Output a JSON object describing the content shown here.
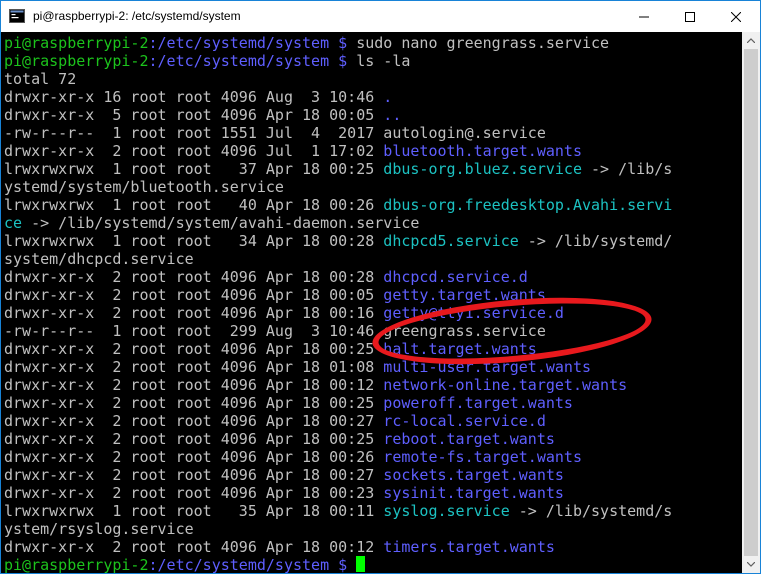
{
  "window": {
    "title": "pi@raspberrypi-2: /etc/systemd/system"
  },
  "controls": {
    "minimize": "minimize",
    "maximize": "maximize",
    "close": "close"
  },
  "lines": [
    [
      {
        "t": "pi@raspberrypi-2",
        "c": "g"
      },
      {
        "t": ":/etc/systemd/system $ ",
        "c": "b"
      },
      {
        "t": "sudo nano greengrass.service",
        "c": "w"
      }
    ],
    [
      {
        "t": "pi@raspberrypi-2",
        "c": "g"
      },
      {
        "t": ":/etc/systemd/system $ ",
        "c": "b"
      },
      {
        "t": "ls -la",
        "c": "w"
      }
    ],
    [
      {
        "t": "total 72",
        "c": "w"
      }
    ],
    [
      {
        "t": "drwxr-xr-x 16 root root 4096 Aug  3 10:46 ",
        "c": "w"
      },
      {
        "t": ".",
        "c": "b"
      }
    ],
    [
      {
        "t": "drwxr-xr-x  5 root root 4096 Apr 18 00:05 ",
        "c": "w"
      },
      {
        "t": "..",
        "c": "b"
      }
    ],
    [
      {
        "t": "-rw-r--r--  1 root root 1551 Jul  4  2017 autologin@.service",
        "c": "w"
      }
    ],
    [
      {
        "t": "drwxr-xr-x  2 root root 4096 Jul  1 17:02 ",
        "c": "w"
      },
      {
        "t": "bluetooth.target.wants",
        "c": "b"
      }
    ],
    [
      {
        "t": "lrwxrwxrwx  1 root root   37 Apr 18 00:25 ",
        "c": "w"
      },
      {
        "t": "dbus-org.bluez.service",
        "c": "c"
      },
      {
        "t": " -> /lib/s",
        "c": "w"
      }
    ],
    [
      {
        "t": "ystemd/system/bluetooth.service",
        "c": "w"
      }
    ],
    [
      {
        "t": "lrwxrwxrwx  1 root root   40 Apr 18 00:26 ",
        "c": "w"
      },
      {
        "t": "dbus-org.freedesktop.Avahi.servi",
        "c": "c"
      }
    ],
    [
      {
        "t": "ce",
        "c": "c"
      },
      {
        "t": " -> /lib/systemd/system/avahi-daemon.service",
        "c": "w"
      }
    ],
    [
      {
        "t": "lrwxrwxrwx  1 root root   34 Apr 18 00:28 ",
        "c": "w"
      },
      {
        "t": "dhcpcd5.service",
        "c": "c"
      },
      {
        "t": " -> /lib/systemd/",
        "c": "w"
      }
    ],
    [
      {
        "t": "system/dhcpcd.service",
        "c": "w"
      }
    ],
    [
      {
        "t": "drwxr-xr-x  2 root root 4096 Apr 18 00:28 ",
        "c": "w"
      },
      {
        "t": "dhcpcd.service.d",
        "c": "b"
      }
    ],
    [
      {
        "t": "drwxr-xr-x  2 root root 4096 Apr 18 00:05 ",
        "c": "w"
      },
      {
        "t": "getty.target.wants",
        "c": "b"
      }
    ],
    [
      {
        "t": "drwxr-xr-x  2 root root 4096 Apr 18 00:16 ",
        "c": "w"
      },
      {
        "t": "getty@tty1.service.d",
        "c": "b"
      }
    ],
    [
      {
        "t": "-rw-r--r--  1 root root  299 Aug  3 10:46 greengrass.service",
        "c": "w"
      }
    ],
    [
      {
        "t": "drwxr-xr-x  2 root root 4096 Apr 18 00:25 ",
        "c": "w"
      },
      {
        "t": "halt.target.wants",
        "c": "b"
      }
    ],
    [
      {
        "t": "drwxr-xr-x  2 root root 4096 Apr 18 01:08 ",
        "c": "w"
      },
      {
        "t": "multi-user.target.wants",
        "c": "b"
      }
    ],
    [
      {
        "t": "drwxr-xr-x  2 root root 4096 Apr 18 00:12 ",
        "c": "w"
      },
      {
        "t": "network-online.target.wants",
        "c": "b"
      }
    ],
    [
      {
        "t": "drwxr-xr-x  2 root root 4096 Apr 18 00:25 ",
        "c": "w"
      },
      {
        "t": "poweroff.target.wants",
        "c": "b"
      }
    ],
    [
      {
        "t": "drwxr-xr-x  2 root root 4096 Apr 18 00:27 ",
        "c": "w"
      },
      {
        "t": "rc-local.service.d",
        "c": "b"
      }
    ],
    [
      {
        "t": "drwxr-xr-x  2 root root 4096 Apr 18 00:25 ",
        "c": "w"
      },
      {
        "t": "reboot.target.wants",
        "c": "b"
      }
    ],
    [
      {
        "t": "drwxr-xr-x  2 root root 4096 Apr 18 00:26 ",
        "c": "w"
      },
      {
        "t": "remote-fs.target.wants",
        "c": "b"
      }
    ],
    [
      {
        "t": "drwxr-xr-x  2 root root 4096 Apr 18 00:27 ",
        "c": "w"
      },
      {
        "t": "sockets.target.wants",
        "c": "b"
      }
    ],
    [
      {
        "t": "drwxr-xr-x  2 root root 4096 Apr 18 00:23 ",
        "c": "w"
      },
      {
        "t": "sysinit.target.wants",
        "c": "b"
      }
    ],
    [
      {
        "t": "lrwxrwxrwx  1 root root   35 Apr 18 00:11 ",
        "c": "w"
      },
      {
        "t": "syslog.service",
        "c": "c"
      },
      {
        "t": " -> /lib/systemd/s",
        "c": "w"
      }
    ],
    [
      {
        "t": "ystem/rsyslog.service",
        "c": "w"
      }
    ],
    [
      {
        "t": "drwxr-xr-x  2 root root 4096 Apr 18 00:12 ",
        "c": "w"
      },
      {
        "t": "timers.target.wants",
        "c": "b"
      }
    ],
    [
      {
        "t": "pi@raspberrypi-2",
        "c": "g"
      },
      {
        "t": ":/etc/systemd/system $ ",
        "c": "b"
      }
    ]
  ],
  "colors": {
    "prompt": "#1cc31c",
    "path": "#5f5fff",
    "dir": "#5f5fff",
    "link": "#1cc2c2",
    "text": "#c0c0c0",
    "cursor": "#00ff00",
    "highlight": "#e8191d"
  },
  "annotation": "red-ellipse-highlight"
}
